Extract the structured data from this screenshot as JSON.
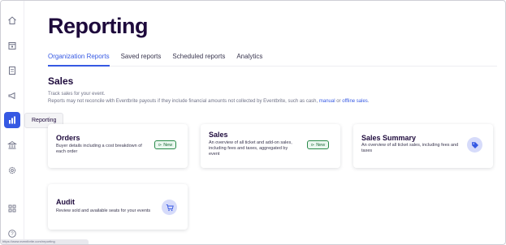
{
  "sidebar": {
    "items": [
      {
        "icon": "home-icon",
        "label": "Home"
      },
      {
        "icon": "calendar-icon",
        "label": "Events"
      },
      {
        "icon": "orders-icon",
        "label": "Orders"
      },
      {
        "icon": "megaphone-icon",
        "label": "Marketing"
      },
      {
        "icon": "bar-chart-icon",
        "label": "Reporting"
      },
      {
        "icon": "bank-icon",
        "label": "Finance"
      },
      {
        "icon": "gear-icon",
        "label": "Settings"
      },
      {
        "icon": "apps-grid-icon",
        "label": "App Marketplace"
      },
      {
        "icon": "help-icon",
        "label": "Help"
      }
    ],
    "active_tooltip": "Reporting"
  },
  "page": {
    "title": "Reporting",
    "tabs": [
      {
        "label": "Organization Reports",
        "active": true
      },
      {
        "label": "Saved reports",
        "active": false
      },
      {
        "label": "Scheduled reports",
        "active": false
      },
      {
        "label": "Analytics",
        "active": false
      }
    ]
  },
  "sales_section": {
    "title": "Sales",
    "line1": "Track sales for your event.",
    "line2_prefix": "Reports may not reconcile with Eventbrite payouts if they include financial amounts not collected by Eventbrite, such as cash,",
    "link_manual": "manual",
    "or_text": "or",
    "link_offline": "offline sales",
    "period": "."
  },
  "cards": {
    "orders": {
      "title": "Orders",
      "desc": "Buyer details including a cost breakdown of each order",
      "badge": "New"
    },
    "sales": {
      "title": "Sales",
      "desc": "An overview of all ticket and add-on sales, including fees and taxes, aggregated by event",
      "badge": "New"
    },
    "sales_summary": {
      "title": "Sales Summary",
      "desc": "An overview of all ticket sales, including fees and taxes"
    },
    "audit": {
      "title": "Audit",
      "desc": "Review sold and available seats for your events"
    }
  },
  "status_bar": "https://www.eventbrite.com/reporting",
  "colors": {
    "accent": "#3659e3",
    "heading": "#1e0a3c",
    "badge_green": "#2a8a4a",
    "icon_bg": "#d6dbfa"
  }
}
